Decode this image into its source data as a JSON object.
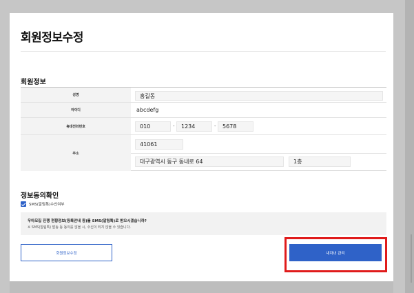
{
  "page": {
    "title": "회원정보수정"
  },
  "member_info": {
    "section_title": "회원정보",
    "name": {
      "label": "성명",
      "value": "홍길동"
    },
    "user_id": {
      "label": "아이디",
      "value": "abcdefg"
    },
    "phone": {
      "label": "휴대전화번호",
      "part1": "010",
      "part2": "1234",
      "part3": "5678",
      "separator": "-"
    },
    "address": {
      "label": "주소",
      "zipcode": "41061",
      "street": "대구광역시 동구 동내로 64",
      "detail": "1층"
    }
  },
  "consent": {
    "section_title": "정보동의확인",
    "sms_label": "SMS(알림톡)수신여부",
    "sms_checked": true,
    "question": "우아모집 진행 현황정보(등록안내 등)를 SMS(알림톡)로 받으시겠습니까?",
    "note": "※ SMS(알림톡) 발송 등 동의를 않을 시, 수신이 되지 않을 수 있습니다."
  },
  "buttons": {
    "edit_label": "회원정보수정",
    "partner_label": "내자녀 관리"
  },
  "colors": {
    "accent": "#2f62c8",
    "highlight": "#e01b1b"
  }
}
